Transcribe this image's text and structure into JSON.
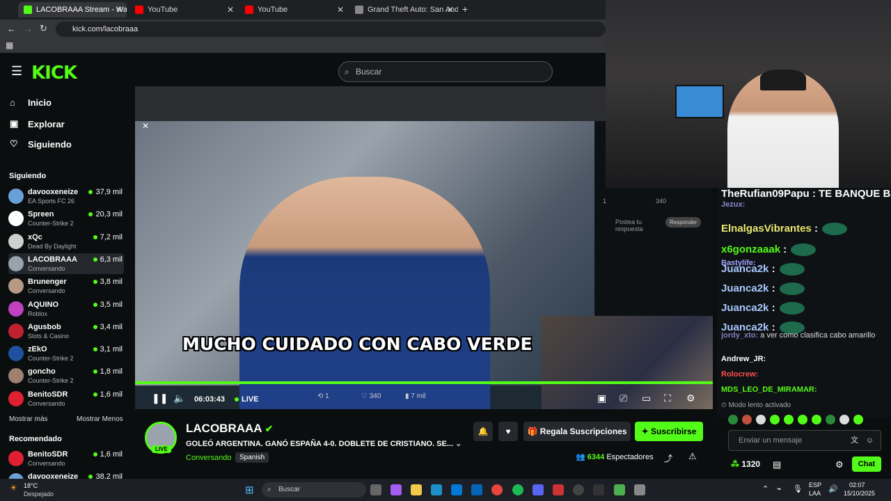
{
  "browser": {
    "tabs": [
      {
        "label": "LACOBRAAA Stream - Watc",
        "color": "#53fc18"
      },
      {
        "label": "YouTube",
        "color": "#ff0000"
      },
      {
        "label": "YouTube",
        "color": "#ff0000"
      },
      {
        "label": "Grand Theft Auto: San Andreas",
        "color": "#888888"
      }
    ],
    "url": "kick.com/lacobraaa"
  },
  "header": {
    "logo": "KICK",
    "search_placeholder": "Buscar"
  },
  "sidebar": {
    "nav": [
      {
        "label": "Inicio",
        "icon": "home-icon"
      },
      {
        "label": "Explorar",
        "icon": "compass-icon"
      },
      {
        "label": "Siguiendo",
        "icon": "heart-icon"
      }
    ],
    "following_title": "Siguiendo",
    "following": [
      {
        "name": "davooxeneize",
        "game": "EA Sports FC 26",
        "viewers": "37,9 mil",
        "color": "#6aa0d8"
      },
      {
        "name": "Spreen",
        "game": "Counter-Strike 2",
        "viewers": "20,3 mil",
        "color": "#ffffff"
      },
      {
        "name": "xQc",
        "game": "Dead By Daylight",
        "viewers": "7,2 mil",
        "color": "#cfcfcf"
      },
      {
        "name": "LACOBRAAA",
        "game": "Conversando",
        "viewers": "6,3 mil",
        "color": "#9aa3ad"
      },
      {
        "name": "Brunenger",
        "game": "Conversando",
        "viewers": "3,8 mil",
        "color": "#b79a86"
      },
      {
        "name": "AQUINO",
        "game": "Roblox",
        "viewers": "3,5 mil",
        "color": "#c040c0"
      },
      {
        "name": "Agusbob",
        "game": "Slots & Casino",
        "viewers": "3,4 mil",
        "color": "#c02030"
      },
      {
        "name": "zEkO",
        "game": "Counter-Strike 2",
        "viewers": "3,1 mil",
        "color": "#2050a0"
      },
      {
        "name": "goncho",
        "game": "Counter-Strike 2",
        "viewers": "1,8 mil",
        "color": "#a08070"
      },
      {
        "name": "BenitoSDR",
        "game": "Conversando",
        "viewers": "1,6 mil",
        "color": "#e02030"
      }
    ],
    "show_more": "Mostrar más",
    "show_less": "Mostrar Menos",
    "recommended_title": "Recomendado",
    "recommended": [
      {
        "name": "BenitoSDR",
        "game": "Conversando",
        "viewers": "1,6 mil",
        "color": "#e02030"
      },
      {
        "name": "davooxeneize",
        "game": "",
        "viewers": "38,2 mil",
        "color": "#6aa0d8"
      }
    ]
  },
  "video": {
    "caption": "MUCHO CUIDADO CON CABO VERDE",
    "time": "06:03:43",
    "live_label": "LIVE",
    "embedded_post": {
      "reply_placeholder": "Postea tu respuesta",
      "reply_button": "Responder",
      "likes": "340",
      "retweets": "1",
      "views": "7 mil"
    }
  },
  "chat": {
    "messages": [
      {
        "user": "TheRufian09Papu",
        "text": ": TE BANQUE BANA JAJAJAJAJAJA",
        "color": "#ffffff",
        "big": true
      },
      {
        "user": "Jezux:",
        "text": "",
        "color": "#8888cc",
        "big": false
      },
      {
        "user": "ElnalgasVibrantes",
        "text": ":",
        "color": "#e8e870",
        "big": true
      },
      {
        "user": "x6gonzaaak",
        "text": ":",
        "color": "#53fc18",
        "big": true
      },
      {
        "user": "Bastylife:",
        "text": "",
        "color": "#a0a0ff",
        "big": false
      },
      {
        "user": "Juanca2k",
        "text": ":",
        "color": "#a8c8ff",
        "big": true
      },
      {
        "user": "Juanca2k",
        "text": ":",
        "color": "#a8c8ff",
        "big": true
      },
      {
        "user": "Juanca2k",
        "text": ":",
        "color": "#a8c8ff",
        "big": true
      },
      {
        "user": "Juanca2k",
        "text": ":",
        "color": "#a8c8ff",
        "big": true
      },
      {
        "user": "jordy_xto:",
        "text": "a ver como clasifica cabo amarillo",
        "color": "#8080c0",
        "big": false
      },
      {
        "user": "Andrew_JR:",
        "text": "",
        "color": "#ffffff",
        "big": false
      },
      {
        "user": "Rolocrew:",
        "text": "",
        "color": "#ff5050",
        "big": false
      },
      {
        "user": "MDS_LEO_DE_MIRAMAR:",
        "text": "",
        "color": "#53fc18",
        "big": false
      }
    ],
    "slow_mode": "Modo lento activado",
    "input_placeholder": "Enviar un mensaje",
    "points": "1320",
    "send_label": "Chat"
  },
  "stream": {
    "channel": "LACOBRAAA",
    "title": "GOLEÓ ARGENTINA. GANÓ ESPAÑA 4-0. DOBLETE DE CRISTIANO. SE...",
    "category": "Conversando",
    "language": "Spanish",
    "live_tag": "LIVE",
    "gift_label": "Regala Suscripciones",
    "subscribe_label": "Suscribirse",
    "viewers": "6344",
    "viewers_label": "Espectadores"
  },
  "taskbar": {
    "weather_temp": "18°C",
    "weather_desc": "Despejado",
    "search_placeholder": "Buscar",
    "lang": "ESP",
    "lang2": "LAA",
    "time": "02:07",
    "date": "15/10/2025"
  }
}
